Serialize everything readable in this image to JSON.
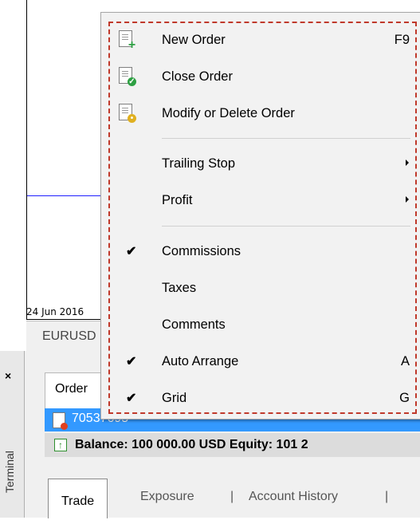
{
  "chart": {
    "date_label": "24 Jun 2016",
    "symbol_tab": "EURUSD",
    "line_color": "#1f1fff"
  },
  "terminal": {
    "side_label": "Terminal",
    "close_glyph": "×",
    "orders_header": "Order",
    "selected_ticket": "70537695",
    "balance_text": "Balance: 100 000.00 USD  Equity: 101 2",
    "tabs": [
      {
        "label": "Trade",
        "active": true
      },
      {
        "label": "Exposure",
        "active": false
      },
      {
        "label": "Account History",
        "active": false
      }
    ],
    "tab_separator": "|"
  },
  "context_menu": {
    "highlight_color": "#c0392b",
    "items": [
      {
        "label": "New Order",
        "shortcut": "F9",
        "icon": "new-order-icon"
      },
      {
        "label": "Close Order",
        "icon": "close-order-icon"
      },
      {
        "label": "Modify or Delete Order",
        "icon": "modify-order-icon"
      },
      {
        "label": "Trailing Stop",
        "submenu": true
      },
      {
        "label": "Profit",
        "submenu": true
      },
      {
        "label": "Commissions",
        "checked": true
      },
      {
        "label": "Taxes",
        "checked": false
      },
      {
        "label": "Comments",
        "checked": false
      },
      {
        "label": "Auto Arrange",
        "checked": true,
        "shortcut": "A"
      },
      {
        "label": "Grid",
        "checked": true,
        "shortcut": "G"
      }
    ],
    "check_glyph": "✔"
  }
}
